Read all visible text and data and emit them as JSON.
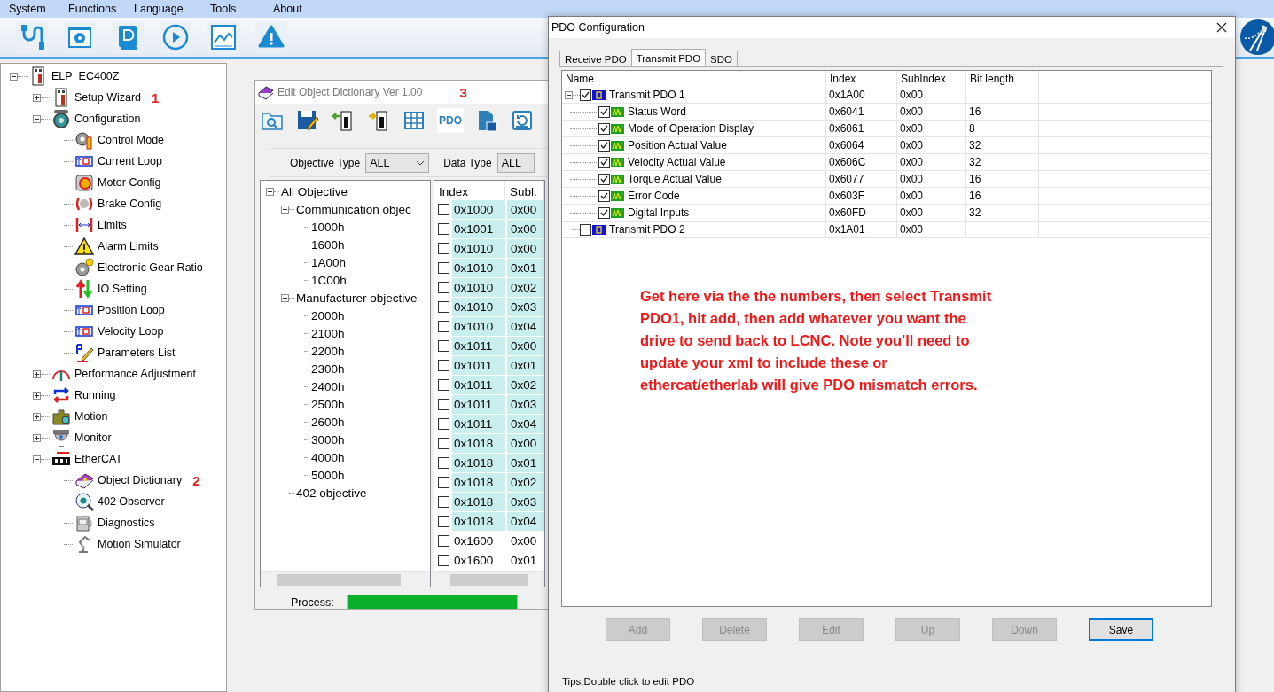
{
  "menu": [
    "System",
    "Functions",
    "Language",
    "Tools",
    "About"
  ],
  "nav_tree": {
    "label": "ELP_EC400Z",
    "expanded": true,
    "children": [
      {
        "label": "Setup Wizard",
        "expanded": false,
        "note": "1"
      },
      {
        "label": "Configuration",
        "expanded": true,
        "children": [
          {
            "label": "Control Mode"
          },
          {
            "label": "Current Loop"
          },
          {
            "label": "Motor Config"
          },
          {
            "label": "Brake Config"
          },
          {
            "label": "Limits"
          },
          {
            "label": "Alarm Limits"
          },
          {
            "label": "Electronic Gear Ratio"
          },
          {
            "label": "IO Setting"
          },
          {
            "label": "Position Loop"
          },
          {
            "label": "Velocity Loop"
          },
          {
            "label": "Parameters List"
          }
        ]
      },
      {
        "label": "Performance Adjustment",
        "expanded": false
      },
      {
        "label": "Running",
        "expanded": false
      },
      {
        "label": "Motion",
        "expanded": false
      },
      {
        "label": "Monitor",
        "expanded": false
      },
      {
        "label": "EtherCAT",
        "expanded": true,
        "children": [
          {
            "label": "Object Dictionary",
            "note": "2"
          },
          {
            "label": "402 Observer"
          },
          {
            "label": "Diagnostics"
          },
          {
            "label": "Motion Simulator"
          }
        ]
      }
    ]
  },
  "dictionary_window": {
    "title": "Edit Object Dictionary Ver 1.00",
    "note": "3",
    "pdo_button": "PDO",
    "filters": [
      {
        "label": "Objective Type",
        "value": "ALL"
      },
      {
        "label": "Data Type",
        "value": "ALL"
      }
    ],
    "tree": {
      "label": "All Objective",
      "expanded": true,
      "children": [
        {
          "label": "Communication objec",
          "expanded": true,
          "children": [
            {
              "label": "1000h"
            },
            {
              "label": "1600h"
            },
            {
              "label": "1A00h"
            },
            {
              "label": "1C00h"
            }
          ]
        },
        {
          "label": "Manufacturer objective",
          "expanded": true,
          "children": [
            {
              "label": "2000h"
            },
            {
              "label": "2100h"
            },
            {
              "label": "2200h"
            },
            {
              "label": "2300h"
            },
            {
              "label": "2400h"
            },
            {
              "label": "2500h"
            },
            {
              "label": "2600h"
            },
            {
              "label": "3000h"
            },
            {
              "label": "4000h"
            },
            {
              "label": "5000h"
            }
          ]
        },
        {
          "label": "402 objective"
        }
      ]
    },
    "table": {
      "columns": [
        "Index",
        "Subl."
      ],
      "rows": [
        {
          "checked": false,
          "highlighted": true,
          "cells": [
            "0x1000",
            "0x00"
          ]
        },
        {
          "checked": false,
          "highlighted": true,
          "cells": [
            "0x1001",
            "0x00"
          ]
        },
        {
          "checked": false,
          "highlighted": true,
          "cells": [
            "0x1010",
            "0x00"
          ]
        },
        {
          "checked": false,
          "highlighted": true,
          "cells": [
            "0x1010",
            "0x01"
          ]
        },
        {
          "checked": false,
          "highlighted": true,
          "cells": [
            "0x1010",
            "0x02"
          ]
        },
        {
          "checked": false,
          "highlighted": true,
          "cells": [
            "0x1010",
            "0x03"
          ]
        },
        {
          "checked": false,
          "highlighted": true,
          "cells": [
            "0x1010",
            "0x04"
          ]
        },
        {
          "checked": false,
          "highlighted": true,
          "cells": [
            "0x1011",
            "0x00"
          ]
        },
        {
          "checked": false,
          "highlighted": true,
          "cells": [
            "0x1011",
            "0x01"
          ]
        },
        {
          "checked": false,
          "highlighted": true,
          "cells": [
            "0x1011",
            "0x02"
          ]
        },
        {
          "checked": false,
          "highlighted": true,
          "cells": [
            "0x1011",
            "0x03"
          ]
        },
        {
          "checked": false,
          "highlighted": true,
          "cells": [
            "0x1011",
            "0x04"
          ]
        },
        {
          "checked": false,
          "highlighted": true,
          "cells": [
            "0x1018",
            "0x00"
          ]
        },
        {
          "checked": false,
          "highlighted": true,
          "cells": [
            "0x1018",
            "0x01"
          ]
        },
        {
          "checked": false,
          "highlighted": true,
          "cells": [
            "0x1018",
            "0x02"
          ]
        },
        {
          "checked": false,
          "highlighted": true,
          "cells": [
            "0x1018",
            "0x03"
          ]
        },
        {
          "checked": false,
          "highlighted": true,
          "cells": [
            "0x1018",
            "0x04"
          ]
        },
        {
          "checked": false,
          "highlighted": false,
          "cells": [
            "0x1600",
            "0x00"
          ]
        },
        {
          "checked": false,
          "highlighted": false,
          "cells": [
            "0x1600",
            "0x01"
          ]
        }
      ]
    },
    "process": {
      "label": "Process:",
      "level": 1
    }
  },
  "pdo_dialog": {
    "title": "PDO Configuration",
    "tabs": [
      {
        "label": "Receive PDO",
        "selected": false
      },
      {
        "label": "Transmit PDO",
        "selected": true
      },
      {
        "label": "SDO",
        "selected": false
      }
    ],
    "columns": [
      "Name",
      "Index",
      "SubIndex",
      "Bit length"
    ],
    "groups": [
      {
        "name": "Transmit PDO 1",
        "index": "0x1A00",
        "subindex": "0x00",
        "checked": true,
        "expanded": true,
        "children": [
          {
            "name": "Status Word",
            "index": "0x6041",
            "subindex": "0x00",
            "bits": "16",
            "checked": true
          },
          {
            "name": "Mode of Operation Display",
            "index": "0x6061",
            "subindex": "0x00",
            "bits": "8",
            "checked": true
          },
          {
            "name": "Position Actual Value",
            "index": "0x6064",
            "subindex": "0x00",
            "bits": "32",
            "checked": true
          },
          {
            "name": "Velocity Actual Value",
            "index": "0x606C",
            "subindex": "0x00",
            "bits": "32",
            "checked": true
          },
          {
            "name": "Torque Actual Value",
            "index": "0x6077",
            "subindex": "0x00",
            "bits": "16",
            "checked": true
          },
          {
            "name": "Error Code",
            "index": "0x603F",
            "subindex": "0x00",
            "bits": "16",
            "checked": true
          },
          {
            "name": "Digital Inputs",
            "index": "0x60FD",
            "subindex": "0x00",
            "bits": "32",
            "checked": true
          }
        ]
      },
      {
        "name": "Transmit PDO 2",
        "index": "0x1A01",
        "subindex": "0x00",
        "checked": false
      }
    ],
    "annotation": "Get here via the the numbers, then select Transmit PDO1, hit add, then add whatever you want the drive to send back to LCNC. Note you'll need to update your xml to include these or ethercat/etherlab will give PDO mismatch errors.",
    "buttons": [
      {
        "label": "Add",
        "disabled": true
      },
      {
        "label": "Delete",
        "disabled": true
      },
      {
        "label": "Edit",
        "disabled": true
      },
      {
        "label": "Up",
        "disabled": true
      },
      {
        "label": "Down",
        "disabled": true
      },
      {
        "label": "Save",
        "disabled": false
      }
    ],
    "tips": "Tips:Double click to edit PDO"
  }
}
